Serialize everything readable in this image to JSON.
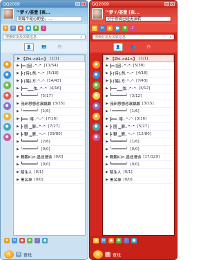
{
  "left": {
    "title": "QQ2009",
    "nickname": "™梦ゞ/荟萱",
    "nick_tag": "[表...",
    "signature": "到每个轮心的全。…",
    "search_placeholder": "搜索好友及关联信息",
    "groups": [
      {
        "name": "【Zhi-<A1>】",
        "count": "[1/1]",
        "selected": true
      },
      {
        "name": "┣━.[因..^-^",
        "count": "[11/54]"
      },
      {
        "name": "┣ [侍].然.^-^",
        "count": "[5/18]"
      },
      {
        "name": "┣ [幅].方.^-^",
        "count": "[14/43]"
      },
      {
        "name": "┣━━▁▁弦..^-^",
        "count": "[4/16]"
      },
      {
        "name": "┗━━━━━━╯",
        "count": "[5/17]"
      },
      {
        "name": "茂织思想恣滚觑觑",
        "count": "[3/15]"
      },
      {
        "name": "╯━━━━━━╯",
        "count": "[1/6]"
      },
      {
        "name": "┣━━..喀..^-^",
        "count": "[7/16]"
      },
      {
        "name": "┣ 图 ▁聊..^-^",
        "count": "[7/27]"
      },
      {
        "name": "┣ 鞭 ▁鹿..^-^",
        "count": "[29/80]"
      },
      {
        "name": "┗━━━━━━╯",
        "count": "[2/6]"
      },
      {
        "name": "╰━━━━━━╯",
        "count": "[0/0]"
      },
      {
        "name": "鞭鹏K1n.墨途漫谈",
        "count": "[0/0]"
      },
      {
        "name": "┗━━━━━━╯",
        "count": "[0/0]"
      },
      {
        "name": "陌生人",
        "count": "[0/1]"
      },
      {
        "name": "黑名单",
        "count": "[0/0]"
      }
    ],
    "find_label": "查找"
  },
  "right": {
    "title": "QQ2009",
    "nickname": "™梦ゞ/荟萱",
    "nick_tag": "[表...",
    "signature": "对于你说已经无法转",
    "search_placeholder": "搜索好友及关联信息",
    "groups": [
      {
        "name": "【Zhi-<A1>】",
        "count": "[1/1]",
        "selected": true
      },
      {
        "name": "┣━.[因..^-^",
        "count": "[5/38]"
      },
      {
        "name": "┣ [侍].然.^-^",
        "count": "[4/18]"
      },
      {
        "name": "┣ [幅].方.^-^",
        "count": "[7/43]"
      },
      {
        "name": "┣━━▁▁弦..^-^",
        "count": "[3/12]"
      },
      {
        "name": "┗━━━━━━╯",
        "count": "[3/12]"
      },
      {
        "name": "茂织思想恣滚觑觑",
        "count": "[3/15]"
      },
      {
        "name": "╯━━━━━━╯",
        "count": "[1/6]"
      },
      {
        "name": "┣━━..喀..^-^",
        "count": "[3/16]"
      },
      {
        "name": "┣ 图 ▁聊..^-^",
        "count": "[5/27]"
      },
      {
        "name": "┣ 鞭 ▁鹿..^-^",
        "count": "[12/80]"
      },
      {
        "name": "┗━━━━━━╯",
        "count": "[1/6]"
      },
      {
        "name": "╰━━━━━━╯",
        "count": "[0/0]"
      },
      {
        "name": "鞭鹏K1n.墨途漫谈",
        "count": "[17/129]"
      },
      {
        "name": "┗━━━━━━╯",
        "count": "[0/0]"
      },
      {
        "name": "陌生人",
        "count": "[0/1]"
      },
      {
        "name": "黑名单",
        "count": "[0/0]"
      }
    ],
    "find_label": "查找"
  }
}
